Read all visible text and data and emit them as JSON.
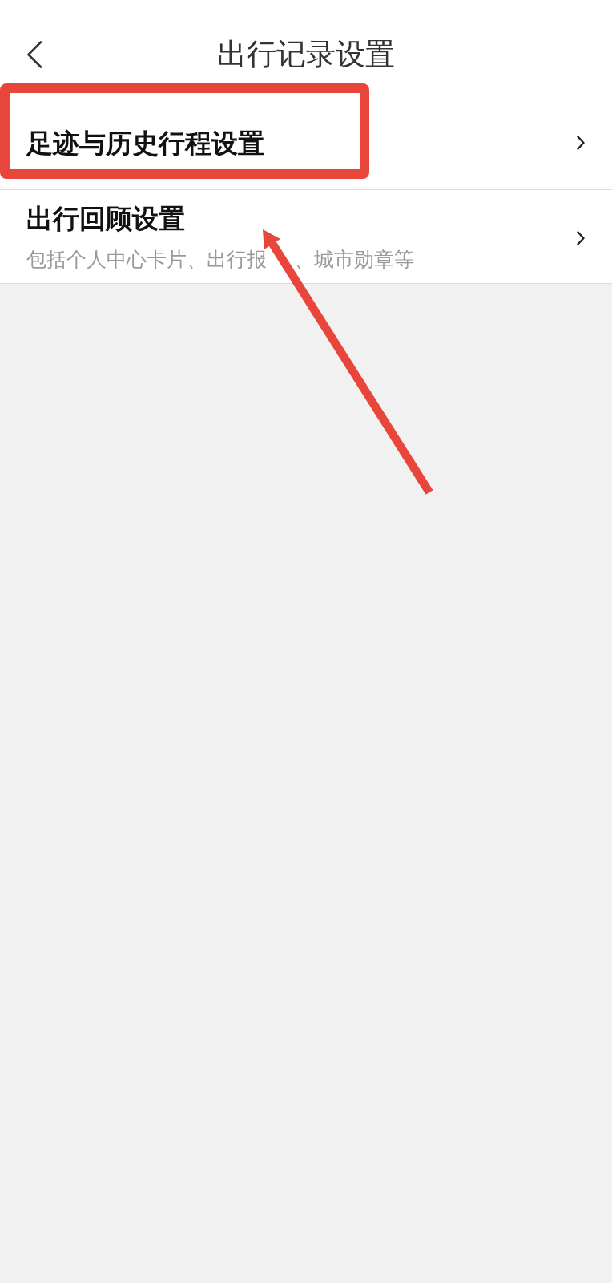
{
  "header": {
    "title": "出行记录设置"
  },
  "settings_items": [
    {
      "title": "足迹与历史行程设置",
      "highlighted": true
    },
    {
      "title": "出行回顾设置",
      "subtitle_parts": [
        "包括个人中心卡片、出行报",
        "、城市勋章等"
      ],
      "highlighted": false
    }
  ]
}
